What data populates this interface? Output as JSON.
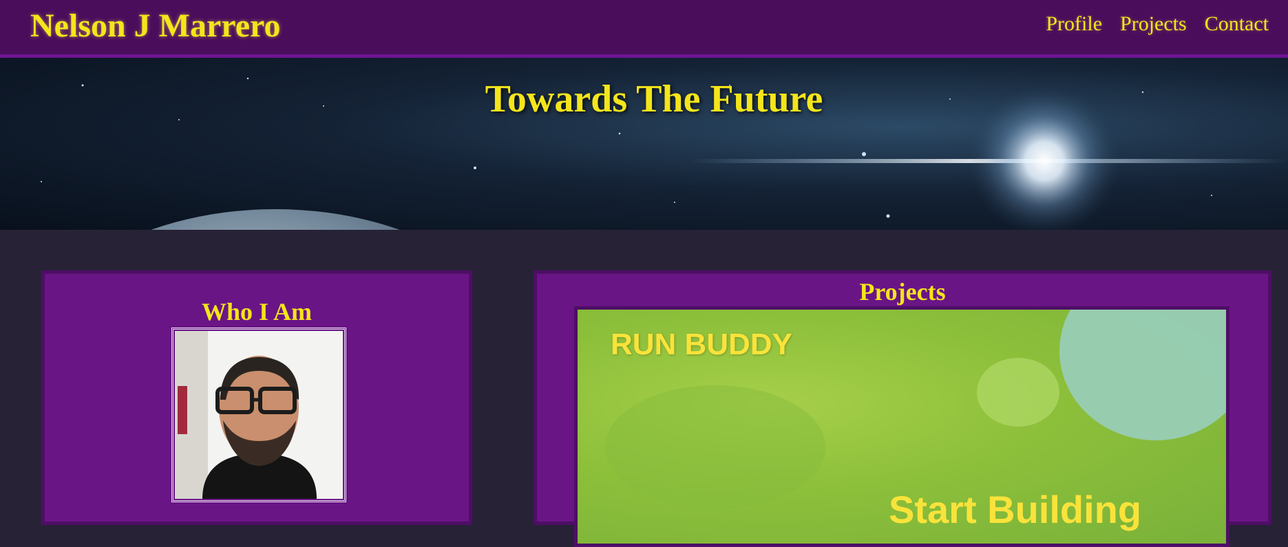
{
  "header": {
    "site_name": "Nelson J Marrero",
    "nav": [
      "Profile",
      "Projects",
      "Contact"
    ]
  },
  "hero": {
    "title": "Towards The Future"
  },
  "about": {
    "title": "Who I Am"
  },
  "projects": {
    "title": "Projects",
    "featured": {
      "name": "RUN BUDDY",
      "tagline": "Start Building"
    }
  },
  "colors": {
    "header_bg": "#4a0d5c",
    "card_bg": "#6a1586",
    "page_bg": "#272236",
    "accent_text": "#f4e51b"
  }
}
